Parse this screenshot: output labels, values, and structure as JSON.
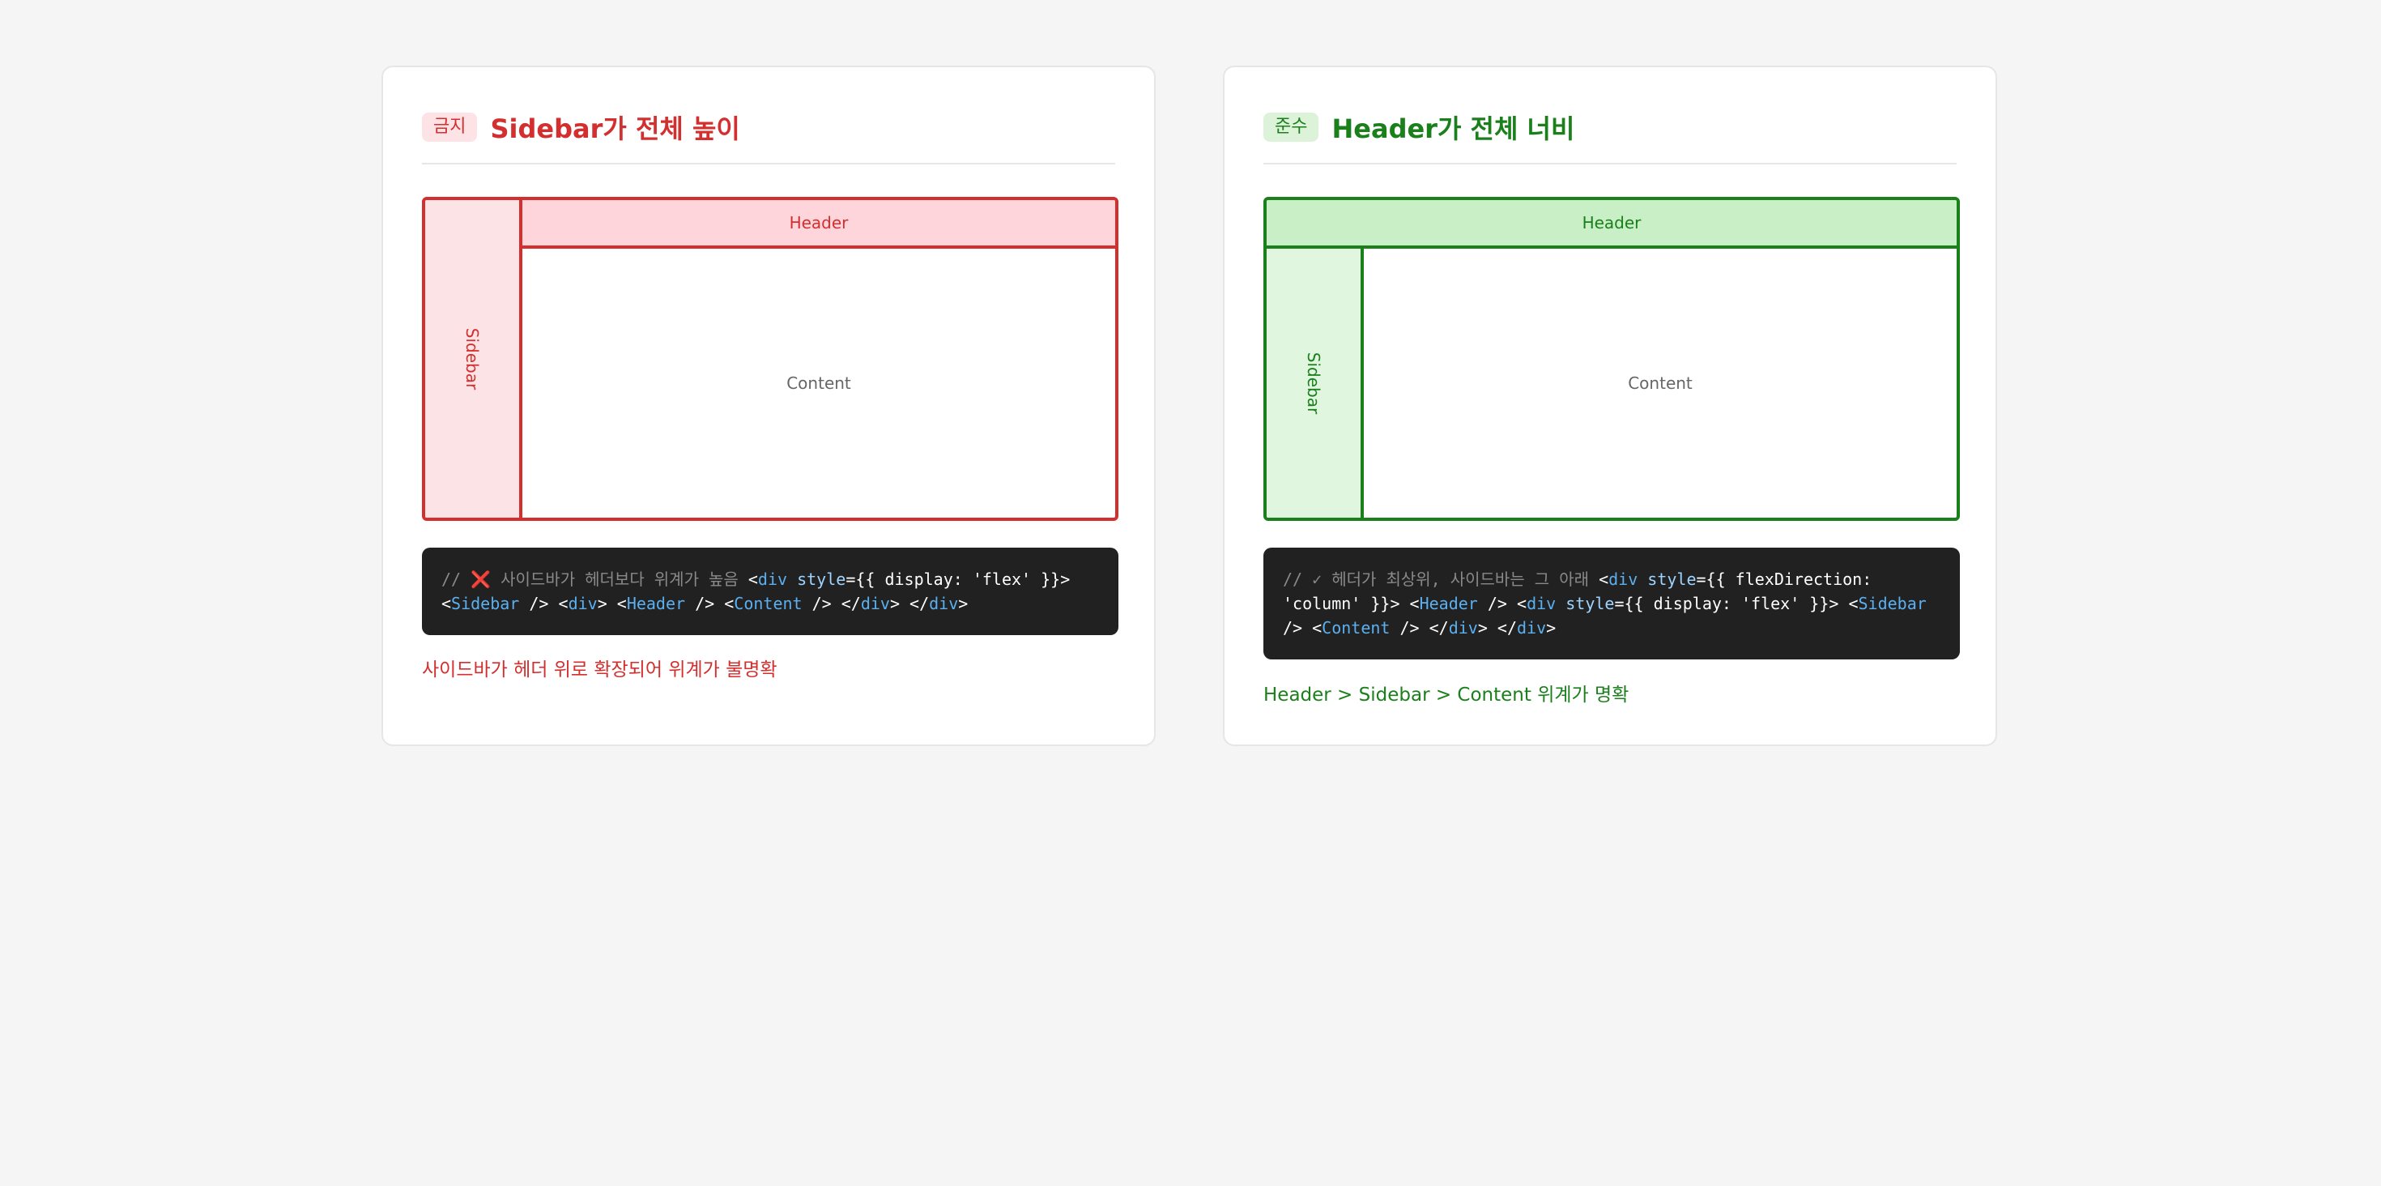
{
  "colors": {
    "bad": "#d32f2f",
    "good": "#1b7f1b",
    "code_bg": "#212121",
    "background": "#f5f5f5"
  },
  "bad_card": {
    "badge": "금지",
    "title": "Sidebar가 전체 높이",
    "diagram": {
      "header": "Header",
      "sidebar": "Sidebar",
      "content": "Content"
    },
    "code": {
      "comment_prefix": "//",
      "icon": "cross-mark-icon",
      "icon_glyph": "❌",
      "comment_text": "사이드바가 헤더보다 위계가 높음",
      "tokens": [
        {
          "t": "<",
          "c": "plain"
        },
        {
          "t": "div",
          "c": "tag"
        },
        {
          "t": " ",
          "c": "plain"
        },
        {
          "t": "style",
          "c": "attr"
        },
        {
          "t": "={{ display: 'flex' }}>",
          "c": "plain"
        },
        {
          "t": " <",
          "c": "plain"
        },
        {
          "t": "Sidebar",
          "c": "tag"
        },
        {
          "t": " /> <",
          "c": "plain"
        },
        {
          "t": "div",
          "c": "tag"
        },
        {
          "t": "> <",
          "c": "plain"
        },
        {
          "t": "Header",
          "c": "tag"
        },
        {
          "t": " /> <",
          "c": "plain"
        },
        {
          "t": "Content",
          "c": "tag"
        },
        {
          "t": " /> </",
          "c": "plain"
        },
        {
          "t": "div",
          "c": "tag"
        },
        {
          "t": "> </",
          "c": "plain"
        },
        {
          "t": "div",
          "c": "tag"
        },
        {
          "t": ">",
          "c": "plain"
        }
      ]
    },
    "description": "사이드바가 헤더 위로 확장되어 위계가 불명확"
  },
  "good_card": {
    "badge": "준수",
    "title": "Header가 전체 너비",
    "diagram": {
      "header": "Header",
      "sidebar": "Sidebar",
      "content": "Content"
    },
    "code": {
      "comment": "// ✓ 헤더가 최상위, 사이드바는 그 아래",
      "tokens": [
        {
          "t": "<",
          "c": "plain"
        },
        {
          "t": "div",
          "c": "tag"
        },
        {
          "t": " ",
          "c": "plain"
        },
        {
          "t": "style",
          "c": "attr"
        },
        {
          "t": "={{ flexDirection: 'column' }}>",
          "c": "plain"
        },
        {
          "t": " <",
          "c": "plain"
        },
        {
          "t": "Header",
          "c": "tag"
        },
        {
          "t": " /> <",
          "c": "plain"
        },
        {
          "t": "div",
          "c": "tag"
        },
        {
          "t": " ",
          "c": "plain"
        },
        {
          "t": "style",
          "c": "attr"
        },
        {
          "t": "={{ display: 'flex' }}> <",
          "c": "plain"
        },
        {
          "t": "Sidebar",
          "c": "tag"
        },
        {
          "t": " /> <",
          "c": "plain"
        },
        {
          "t": "Content",
          "c": "tag"
        },
        {
          "t": " /> </",
          "c": "plain"
        },
        {
          "t": "div",
          "c": "tag"
        },
        {
          "t": "> </",
          "c": "plain"
        },
        {
          "t": "div",
          "c": "tag"
        },
        {
          "t": ">",
          "c": "plain"
        }
      ]
    },
    "description": "Header > Sidebar > Content 위계가 명확"
  }
}
